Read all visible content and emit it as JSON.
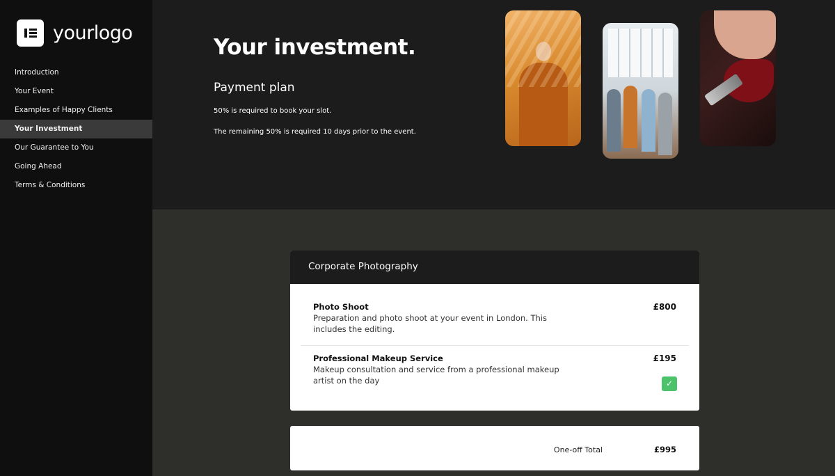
{
  "logo": {
    "text": "yourlogo",
    "icon": "elementor-icon"
  },
  "sidebar": {
    "items": [
      {
        "label": "Introduction"
      },
      {
        "label": "Your Event"
      },
      {
        "label": "Examples of Happy Clients"
      },
      {
        "label": "Your Investment",
        "active": true
      },
      {
        "label": "Our Guarantee to You"
      },
      {
        "label": "Going Ahead"
      },
      {
        "label": "Terms & Conditions"
      }
    ]
  },
  "hero": {
    "title": "Your investment.",
    "subtitle": "Payment plan",
    "line1": "50% is required to book your slot.",
    "line2": "The remaining 50% is required 10 days prior to the event."
  },
  "pricing": {
    "header": "Corporate Photography",
    "items": [
      {
        "title": "Photo Shoot",
        "description": "Preparation and photo shoot at your event in London. This includes the editing.",
        "price": "£800"
      },
      {
        "title": "Professional Makeup Service",
        "description": "Makeup consultation and service from a professional makeup artist on the day",
        "price": "£195",
        "checkbox_glyph": "✓"
      }
    ],
    "total_label": "One-off Total",
    "total_value": "£995"
  },
  "colors": {
    "accent_check": "#4cc26a",
    "sidebar_bg": "#0f0f0f",
    "hero_bg": "#1c1c1c"
  }
}
